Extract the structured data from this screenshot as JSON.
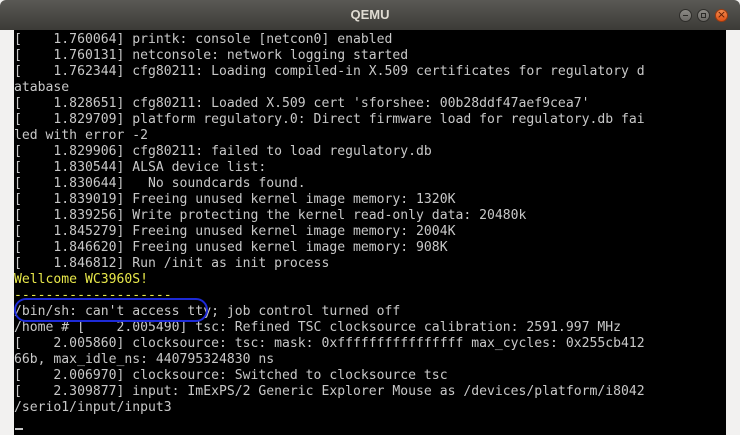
{
  "window": {
    "title": "QEMU"
  },
  "terminal": {
    "lines": [
      {
        "text": "[    1.760064] printk: console [netcon0] enabled"
      },
      {
        "text": "[    1.760131] netconsole: network logging started"
      },
      {
        "text": "[    1.762344] cfg80211: Loading compiled-in X.509 certificates for regulatory d"
      },
      {
        "text": "atabase"
      },
      {
        "text": "[    1.828651] cfg80211: Loaded X.509 cert 'sforshee: 00b28ddf47aef9cea7'"
      },
      {
        "text": "[    1.829709] platform regulatory.0: Direct firmware load for regulatory.db fai"
      },
      {
        "text": "led with error -2"
      },
      {
        "text": "[    1.829906] cfg80211: failed to load regulatory.db"
      },
      {
        "text": "[    1.830544] ALSA device list:"
      },
      {
        "text": "[    1.830644]   No soundcards found."
      },
      {
        "text": "[    1.839019] Freeing unused kernel image memory: 1320K"
      },
      {
        "text": "[    1.839256] Write protecting the kernel read-only data: 20480k"
      },
      {
        "text": "[    1.845279] Freeing unused kernel image memory: 2004K"
      },
      {
        "text": "[    1.846620] Freeing unused kernel image memory: 908K"
      },
      {
        "text": "[    1.846812] Run /init as init process"
      },
      {
        "text": "Wellcome WC3960S!",
        "style": "yellow"
      },
      {
        "text": "--------------------",
        "style": "dash"
      },
      {
        "text": "/bin/sh: can't access tty; job control turned off"
      },
      {
        "text": "/home # [    2.005490] tsc: Refined TSC clocksource calibration: 2591.997 MHz"
      },
      {
        "text": "[    2.005860] clocksource: tsc: mask: 0xffffffffffffffff max_cycles: 0x255cb412"
      },
      {
        "text": "66b, max_idle_ns: 440795324830 ns"
      },
      {
        "text": "[    2.006970] clocksource: Switched to clocksource tsc"
      },
      {
        "text": "[    2.309877] input: ImExPS/2 Generic Explorer Mouse as /devices/platform/i8042"
      },
      {
        "text": "/serio1/input/input3"
      },
      {
        "text": ""
      }
    ]
  },
  "colors": {
    "terminal_bg": "#000000",
    "terminal_fg": "#c8c8c8",
    "welcome_text": "#e8e84a",
    "annotation_circle": "#1d2ad6"
  }
}
